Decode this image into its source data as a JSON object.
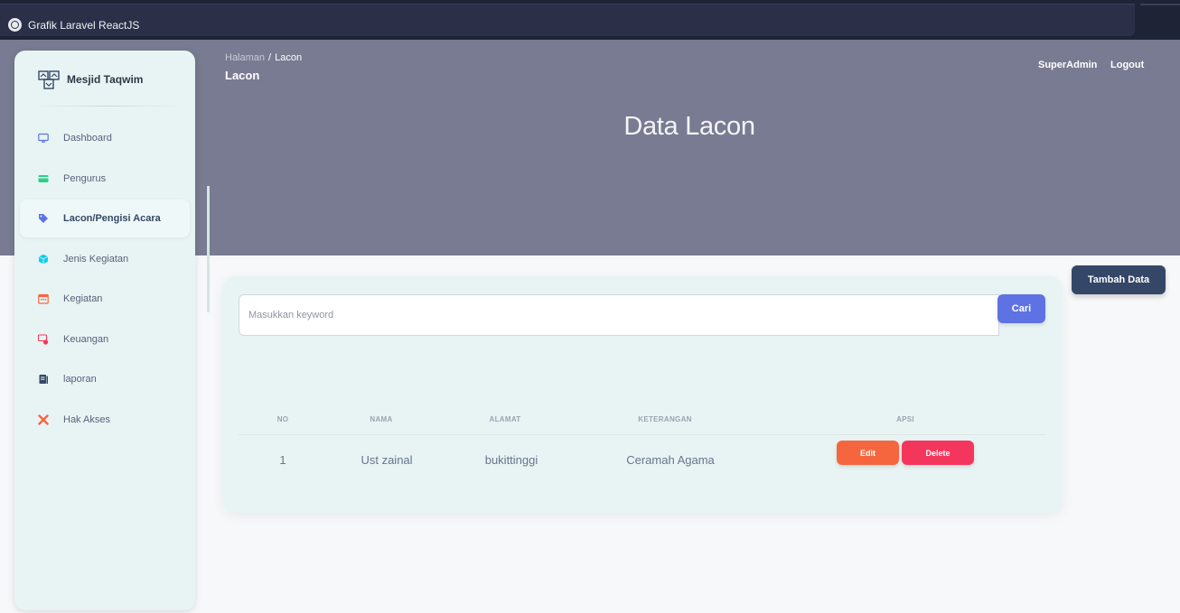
{
  "window": {
    "title": "Grafik Laravel ReactJS"
  },
  "sidebar": {
    "brand": "Mesjid Taqwim",
    "items": [
      {
        "label": "Dashboard",
        "icon": "monitor-icon",
        "color": "#5e72e4"
      },
      {
        "label": "Pengurus",
        "icon": "credit-card-icon",
        "color": "#2dce89"
      },
      {
        "label": "Lacon/Pengisi Acara",
        "icon": "tag-icon",
        "color": "#5e72e4",
        "active": true
      },
      {
        "label": "Jenis Kegiatan",
        "icon": "cube-icon",
        "color": "#11cdef"
      },
      {
        "label": "Kegiatan",
        "icon": "calendar-icon",
        "color": "#fb6340"
      },
      {
        "label": "Keuangan",
        "icon": "money-icon",
        "color": "#f5365c"
      },
      {
        "label": "laporan",
        "icon": "document-icon",
        "color": "#344767"
      },
      {
        "label": "Hak Akses",
        "icon": "tools-icon",
        "color": "#fb6340"
      }
    ]
  },
  "header": {
    "breadcrumb_parent": "Halaman",
    "breadcrumb_separator": "/",
    "breadcrumb_current": "Lacon",
    "page_heading": "Lacon",
    "user": "SuperAdmin",
    "logout": "Logout",
    "hero_title": "Data Lacon"
  },
  "actions": {
    "add_label": "Tambah Data"
  },
  "search": {
    "placeholder": "Masukkan keyword",
    "value": "",
    "button_label": "Cari"
  },
  "table": {
    "columns": [
      "NO",
      "NAMA",
      "ALAMAT",
      "KETERANGAN",
      "APSI"
    ],
    "rows": [
      {
        "no": "1",
        "nama": "Ust zainal",
        "alamat": "bukittinggi",
        "keterangan": "Ceramah Agama",
        "edit": "Edit",
        "delete": "Delete"
      }
    ]
  },
  "colors": {
    "hero": "#787b91",
    "primary": "#5e72e4",
    "dark": "#344767",
    "edit": "#f5663f",
    "delete": "#f5365c"
  }
}
